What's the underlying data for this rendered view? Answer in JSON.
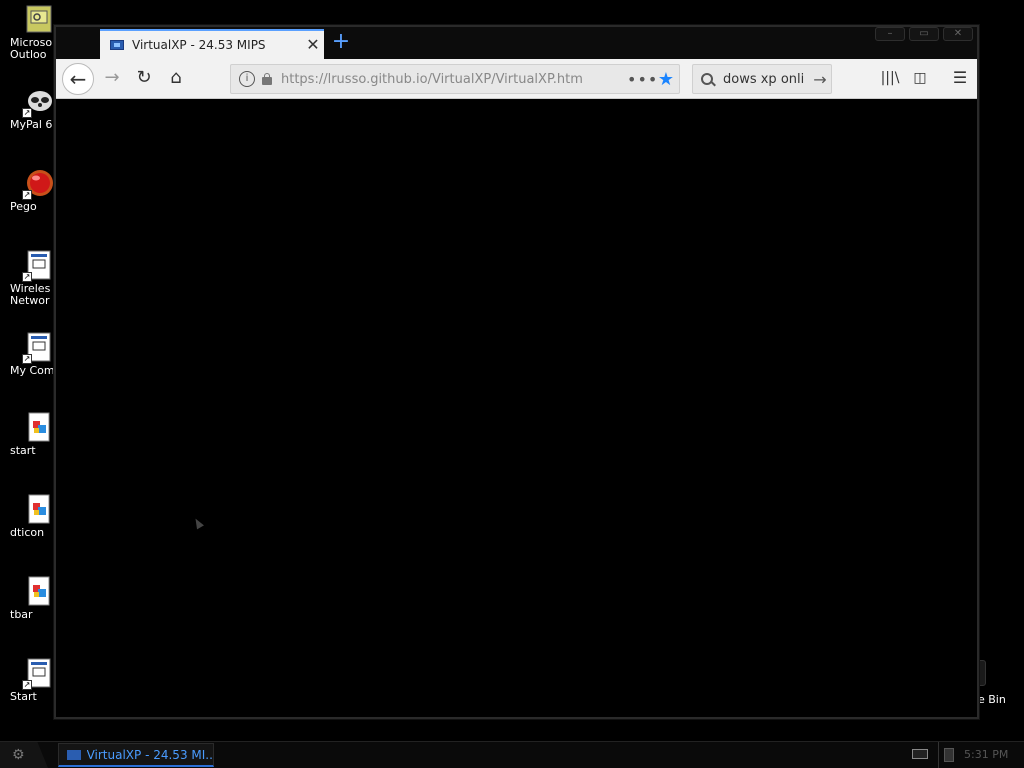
{
  "desktop": {
    "icons": [
      {
        "label": "Microso\nOutloo",
        "line1": "Microso",
        "line2": "Outloo",
        "icon": "outlook-icon"
      },
      {
        "label": "MyPal 6",
        "icon": "raccoon-icon"
      },
      {
        "label": "Pego",
        "icon": "red-orb-icon"
      },
      {
        "line1": "Wireles",
        "line2": "Networ",
        "icon": "document-icon"
      },
      {
        "label": "My Comp",
        "icon": "document-icon"
      },
      {
        "label": "start",
        "icon": "image-file-icon"
      },
      {
        "label": "dticon",
        "icon": "image-file-icon"
      },
      {
        "label": "tbar",
        "icon": "image-file-icon"
      },
      {
        "label": "Start",
        "icon": "document-icon"
      }
    ],
    "recycle_bin_label": "e Bin"
  },
  "browser": {
    "tab_title": "VirtualXP - 24.53 MIPS",
    "url": "https://lrusso.github.io/VirtualXP/VirtualXP.htm",
    "search_value": "dows xp onli",
    "accent_color": "#5aa0ff",
    "star_color": "#1a84ff"
  },
  "taskbar": {
    "task_label": "VirtualXP - 24.53 MI...",
    "clock": "5:31 PM",
    "task_text_color": "#4a9cff"
  }
}
